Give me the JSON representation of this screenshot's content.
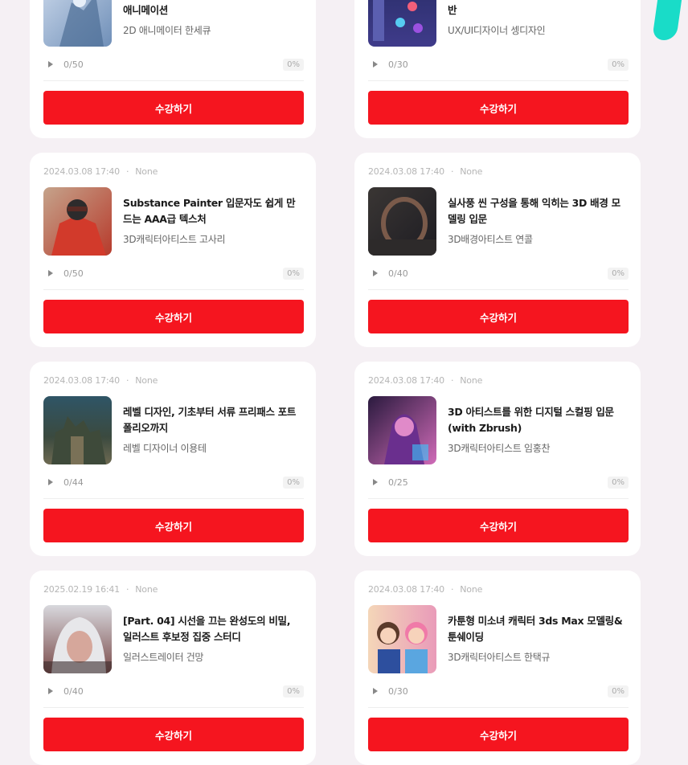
{
  "colors": {
    "page_bg": "#f5f0f4",
    "card_bg": "#ffffff",
    "accent_button": "#f5151f",
    "deco_teal": "#19dcc8"
  },
  "courses": [
    {
      "date": "",
      "status": "",
      "title": "캐릭터에 숨결을 불어넣는 스파인 일러스트 애니메이션",
      "author": "2D 애니메이터 한세큐",
      "progress": "0/50",
      "percent": "0%",
      "button": "수강하기",
      "thumb": "icy-knight"
    },
    {
      "date": "",
      "status": "",
      "title": "게임 UX/UI 디자인 취업 포트폴리오 완성반",
      "author": "UX/UI디자이너 셍디자인",
      "progress": "0/30",
      "percent": "0%",
      "button": "수강하기",
      "thumb": "game-ui"
    },
    {
      "date": "2024.03.08 17:40",
      "status": "None",
      "title": "Substance Painter 입문자도 쉽게 만드는 AAA급 텍스처",
      "author": "3D캐릭터아티스트 고사리",
      "progress": "0/50",
      "percent": "0%",
      "button": "수강하기",
      "thumb": "red-armor"
    },
    {
      "date": "2024.03.08 17:40",
      "status": "None",
      "title": "실사풍 씬 구성을 통해 익히는 3D 배경 모델링 입문",
      "author": "3D배경아티스트 연콜",
      "progress": "0/40",
      "percent": "0%",
      "button": "수강하기",
      "thumb": "dark-scene"
    },
    {
      "date": "2024.03.08 17:40",
      "status": "None",
      "title": "레벨 디자인, 기초부터 서류 프리패스 포트폴리오까지",
      "author": "레벨 디자이너 이용테",
      "progress": "0/44",
      "percent": "0%",
      "button": "수강하기",
      "thumb": "castle"
    },
    {
      "date": "2024.03.08 17:40",
      "status": "None",
      "title": "3D 아티스트를 위한 디지털 스컬핑 입문 (with Zbrush)",
      "author": "3D캐릭터아티스트 임홍찬",
      "progress": "0/25",
      "percent": "0%",
      "button": "수강하기",
      "thumb": "neon-character"
    },
    {
      "date": "2025.02.19 16:41",
      "status": "None",
      "title": "[Part. 04] 시선을 끄는 완성도의 비밀, 일러스트 후보정 집중 스터디",
      "author": "일러스트레이터 건망",
      "progress": "0/40",
      "percent": "0%",
      "button": "수강하기",
      "thumb": "silver-hair"
    },
    {
      "date": "2024.03.08 17:40",
      "status": "None",
      "title": "카툰형 미소녀 캐릭터 3ds Max 모델링&툰쉐이딩",
      "author": "3D캐릭터아티스트 한택규",
      "progress": "0/30",
      "percent": "0%",
      "button": "수강하기",
      "thumb": "cartoon-girls"
    }
  ]
}
